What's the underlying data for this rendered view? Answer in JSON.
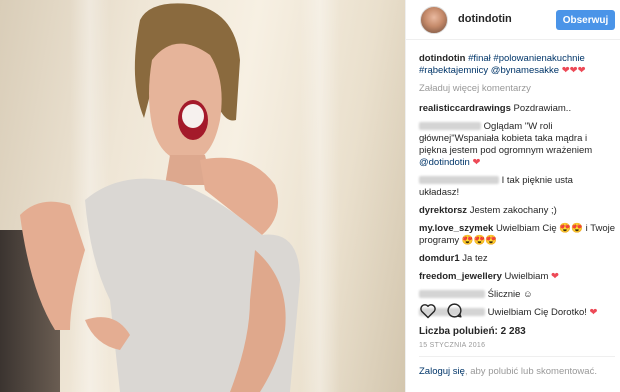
{
  "post": {
    "username": "dotindotin",
    "follow_label": "Obserwuj",
    "caption": {
      "user": "dotindotin",
      "text": "#finał #polowanienakuchnie #rąbektajemnicy @bynamesakke",
      "hearts": "❤❤❤"
    },
    "load_more": "Załaduj więcej komentarzy",
    "comments": [
      {
        "user": "realisticcardrawings",
        "text": "Pozdrawiam.."
      },
      {
        "user": "",
        "text": "Oglądam \"W roli głównej\"Wspaniała kobieta taka mądra i piękna jestem pod ogromnym wrażeniem",
        "mention": "@dotindotin",
        "suffix": "❤"
      },
      {
        "user": "",
        "text": "I tak pięknie usta układasz!"
      },
      {
        "user": "dyrektorsz",
        "text": "Jestem zakochany ;)"
      },
      {
        "user": "my.love_szymek",
        "text": "Uwielbiam Cię",
        "suffix": "😍😍",
        "text2": "i Twoje programy",
        "suffix2": "😍😍😍"
      },
      {
        "user": "domdur1",
        "text": "Ja tez"
      },
      {
        "user": "freedom_jewellery",
        "text": "Uwielbiam",
        "suffix": "❤"
      },
      {
        "user": "",
        "text": "Ślicznie ☺"
      },
      {
        "user": "",
        "text": "Uwielbiam Cię Dorotko!",
        "suffix": "❤"
      }
    ],
    "likes": "Liczba polubień: 2 283",
    "date": "15 STYCZNIA 2016",
    "login_link": "Zaloguj się",
    "login_rest": ", aby polubić lub skomentować."
  },
  "icons": {
    "like": "heart-outline-icon",
    "comment": "comment-bubble-icon"
  },
  "colors": {
    "follow_button": "#4a94e8",
    "hashtag": "#003569",
    "heart": "#ed4956"
  }
}
